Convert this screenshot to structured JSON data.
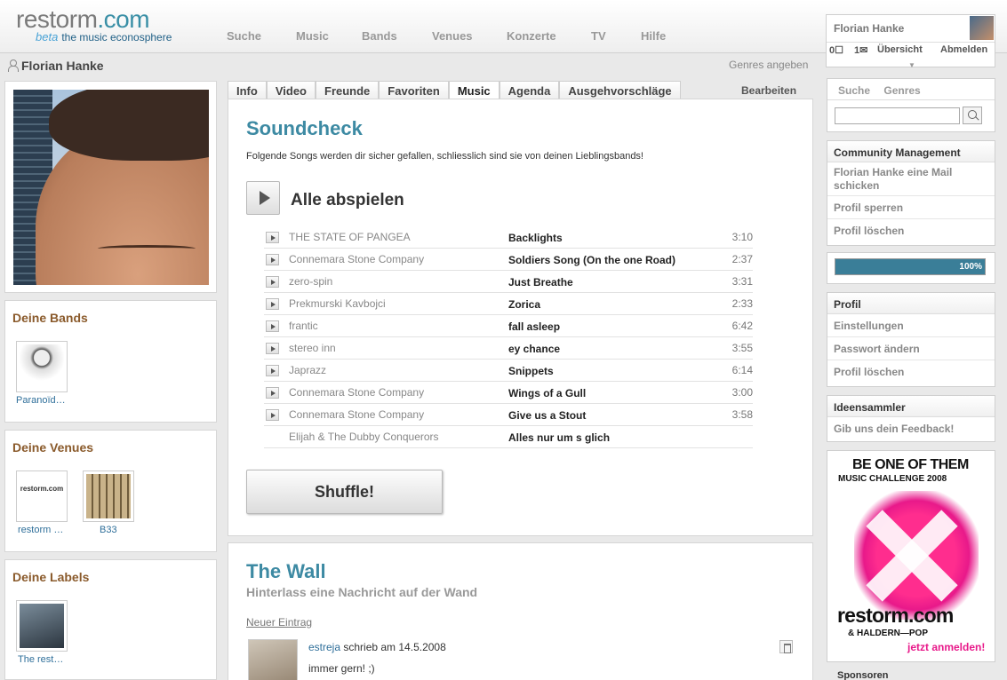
{
  "logo": {
    "name": "restorm",
    "domain": ".com",
    "beta": "beta",
    "tagline": "the music econosphere"
  },
  "nav": [
    "Suche",
    "Music",
    "Bands",
    "Venues",
    "Konzerte",
    "TV",
    "Hilfe"
  ],
  "user": {
    "name": "Florian Hanke",
    "messages": "0",
    "mails": "1",
    "overview": "Übersicht",
    "logout": "Abmelden"
  },
  "profile": {
    "name": "Florian Hanke",
    "genres_link": "Genres angeben"
  },
  "left": {
    "bands": {
      "title": "Deine Bands",
      "items": [
        "Paranoïd…"
      ]
    },
    "venues": {
      "title": "Deine Venues",
      "items": [
        "restorm …",
        "B33"
      ]
    },
    "labels": {
      "title": "Deine Labels",
      "items": [
        "The rest…"
      ]
    }
  },
  "tabs": [
    "Info",
    "Video",
    "Freunde",
    "Favoriten",
    "Music",
    "Agenda",
    "Ausgehvorschläge"
  ],
  "active_tab": "Music",
  "edit_label": "Bearbeiten",
  "soundcheck": {
    "title": "Soundcheck",
    "description": "Folgende Songs werden dir sicher gefallen, schliesslich sind sie von deinen Lieblingsbands!",
    "play_all": "Alle abspielen",
    "songs": [
      {
        "artist": "THE STATE OF PANGEA",
        "title": "Backlights",
        "duration": "3:10",
        "playable": true
      },
      {
        "artist": "Connemara Stone Company",
        "title": "Soldiers Song (On the one Road)",
        "duration": "2:37",
        "playable": true
      },
      {
        "artist": "zero-spin",
        "title": "Just Breathe",
        "duration": "3:31",
        "playable": true
      },
      {
        "artist": "Prekmurski Kavbojci",
        "title": "Zorica",
        "duration": "2:33",
        "playable": true
      },
      {
        "artist": "frantic",
        "title": "fall asleep",
        "duration": "6:42",
        "playable": true
      },
      {
        "artist": "stereo inn",
        "title": "ey chance",
        "duration": "3:55",
        "playable": true
      },
      {
        "artist": "Japrazz",
        "title": "Snippets",
        "duration": "6:14",
        "playable": true
      },
      {
        "artist": "Connemara Stone Company",
        "title": "Wings of a Gull",
        "duration": "3:00",
        "playable": true
      },
      {
        "artist": "Connemara Stone Company",
        "title": "Give us a Stout",
        "duration": "3:58",
        "playable": true
      },
      {
        "artist": "Elijah & The Dubby Conquerors",
        "title": "Alles nur um s glich",
        "duration": "",
        "playable": false
      }
    ],
    "shuffle": "Shuffle!"
  },
  "wall": {
    "title": "The Wall",
    "subtitle": "Hinterlass eine Nachricht auf der Wand",
    "new_entry": "Neuer Eintrag",
    "entry": {
      "user": "estreja",
      "meta": " schrieb am 14.5.2008",
      "text": "immer gern! ;)"
    }
  },
  "right": {
    "search_tabs": [
      "Suche",
      "Genres"
    ],
    "community": {
      "title": "Community Management",
      "items": [
        "Florian Hanke eine Mail schicken",
        "Profil sperren",
        "Profil löschen"
      ]
    },
    "progress": {
      "value": 1.0,
      "label": "100%"
    },
    "profil": {
      "title": "Profil",
      "items": [
        "Einstellungen",
        "Passwort ändern",
        "Profil löschen"
      ]
    },
    "ideen": {
      "title": "Ideensammler",
      "items": [
        "Gib uns dein Feedback!"
      ]
    },
    "ad": {
      "line1": "BE ONE OF THEM",
      "line2": "MUSIC CHALLENGE 2008",
      "line3": "restorm.com",
      "line4": "& HALDERN—POP",
      "line5": "jetzt anmelden!"
    },
    "sponsoren": "Sponsoren"
  },
  "colors": {
    "accent": "#3d8aa3",
    "brown_heading": "#8a5a2b",
    "progress": "#3a7e98",
    "pink": "#e8198a"
  }
}
